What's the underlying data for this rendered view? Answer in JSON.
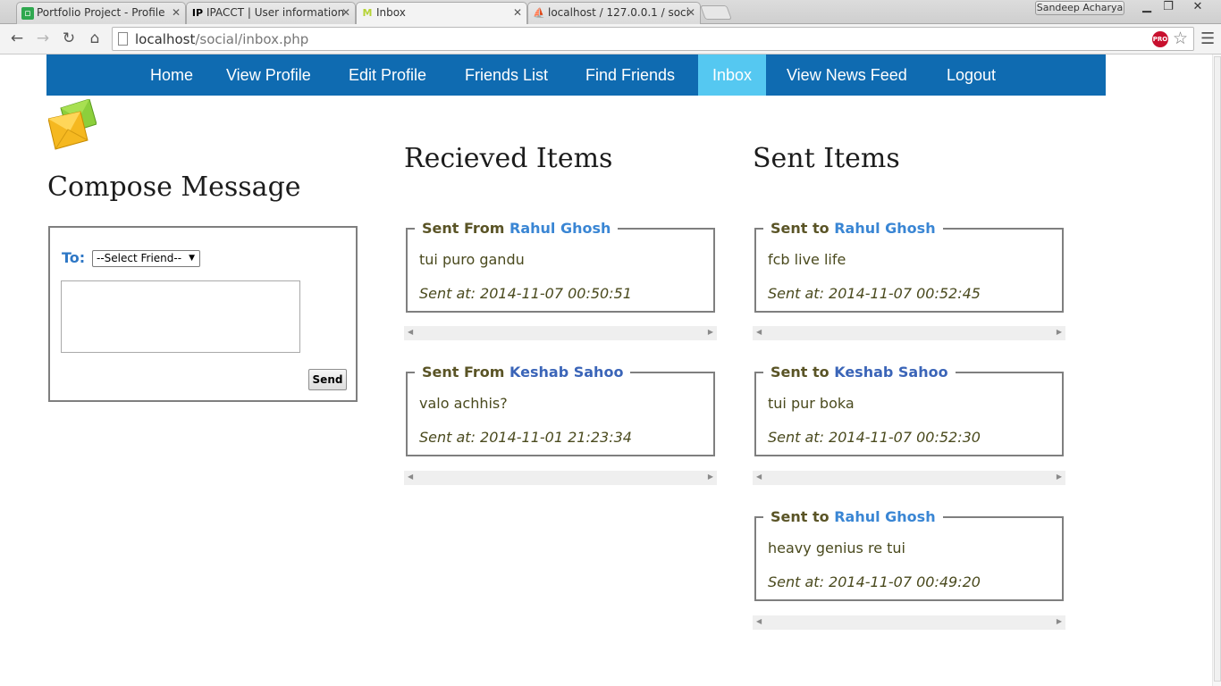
{
  "browser": {
    "tabs": [
      {
        "title": "Portfolio Project - Profile",
        "icon": "portfolio-icon"
      },
      {
        "title": "IPACCT | User information",
        "icon": "ipacct-icon"
      },
      {
        "title": "Inbox",
        "icon": "gmail-icon"
      },
      {
        "title": "localhost / 127.0.0.1 / soci",
        "icon": "phpmyadmin-icon"
      }
    ],
    "profile_name": "Sandeep Acharya",
    "url_host": "localhost",
    "url_path": "/social/inbox.php",
    "extension_badge": "PRO"
  },
  "nav": {
    "items": [
      "Home",
      "View Profile",
      "Edit Profile",
      "Friends List",
      "Find Friends",
      "Inbox",
      "View News Feed",
      "Logout"
    ],
    "active": "Inbox"
  },
  "compose": {
    "heading": "Compose Message",
    "to_label": "To:",
    "friend_select": "--Select Friend--",
    "send_label": "Send"
  },
  "received": {
    "heading": "Recieved Items",
    "items": [
      {
        "prefix": "Sent From",
        "name": "Rahul Ghosh",
        "body": "tui puro gandu",
        "time": "Sent at: 2014-11-07 00:50:51"
      },
      {
        "prefix": "Sent From",
        "name": "Keshab Sahoo",
        "body": "valo achhis?",
        "time": "Sent at: 2014-11-01 21:23:34"
      }
    ]
  },
  "sent": {
    "heading": "Sent Items",
    "items": [
      {
        "prefix": "Sent to",
        "name": "Rahul Ghosh",
        "body": "fcb live life",
        "time": "Sent at: 2014-11-07 00:52:45"
      },
      {
        "prefix": "Sent to",
        "name": "Keshab Sahoo",
        "body": "tui pur boka",
        "time": "Sent at: 2014-11-07 00:52:30"
      },
      {
        "prefix": "Sent to",
        "name": "Rahul Ghosh",
        "body": "heavy genius re tui",
        "time": "Sent at: 2014-11-07 00:49:20"
      }
    ]
  },
  "colors": {
    "navbar": "#0f6bb1",
    "nav_active": "#55c8f1",
    "name_link": "#3a86d4",
    "legend_prefix": "#5a5426"
  }
}
